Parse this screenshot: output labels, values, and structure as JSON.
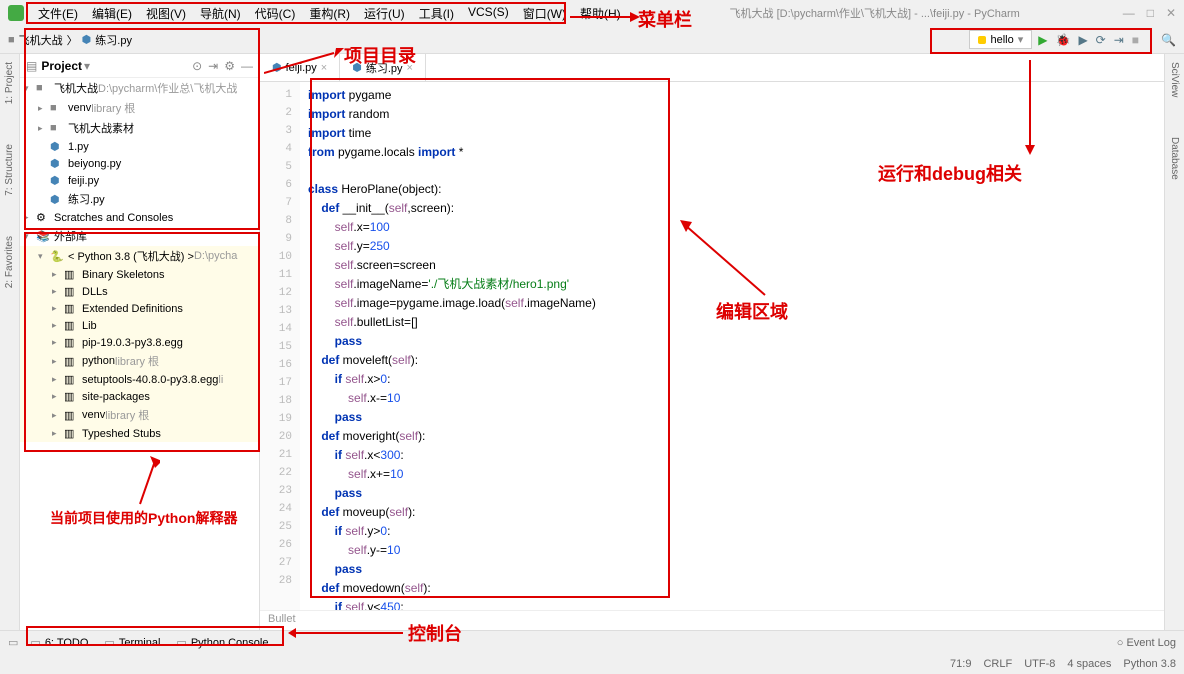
{
  "window": {
    "title": "飞机大战 [D:\\pycharm\\作业\\飞机大战] - ...\\feiji.py - PyCharm"
  },
  "menu": [
    "文件(E)",
    "编辑(E)",
    "视图(V)",
    "导航(N)",
    "代码(C)",
    "重构(R)",
    "运行(U)",
    "工具(I)",
    "VCS(S)",
    "窗口(W)",
    "帮助(H)"
  ],
  "breadcrumb": [
    "飞机大战",
    "练习.py"
  ],
  "run_config": "hello",
  "tabs": [
    "feiji.py",
    "练习.py"
  ],
  "project": {
    "label": "Project",
    "root": {
      "name": "飞机大战",
      "path": "D:\\pycharm\\作业总\\飞机大战"
    },
    "venv": {
      "name": "venv",
      "suffix": "library 根"
    },
    "material": "飞机大战素材",
    "files": [
      "1.py",
      "beiyong.py",
      "feiji.py",
      "练习.py"
    ],
    "scratches": "Scratches and Consoles",
    "external": "外部库",
    "python": {
      "name": "< Python 3.8 (飞机大战) >",
      "path": "D:\\pycha"
    },
    "libs": [
      {
        "name": "Binary Skeletons",
        "suffix": ""
      },
      {
        "name": "DLLs",
        "suffix": ""
      },
      {
        "name": "Extended Definitions",
        "suffix": ""
      },
      {
        "name": "Lib",
        "suffix": ""
      },
      {
        "name": "pip-19.0.3-py3.8.egg",
        "suffix": ""
      },
      {
        "name": "python",
        "suffix": "library 根"
      },
      {
        "name": "setuptools-40.8.0-py3.8.egg",
        "suffix": "li"
      },
      {
        "name": "site-packages",
        "suffix": ""
      },
      {
        "name": "venv",
        "suffix": "library 根"
      },
      {
        "name": "Typeshed Stubs",
        "suffix": ""
      }
    ]
  },
  "code_lines": [
    [
      {
        "t": "import",
        "c": "kw"
      },
      {
        "t": " pygame",
        "c": "ident"
      }
    ],
    [
      {
        "t": "import",
        "c": "kw"
      },
      {
        "t": " random",
        "c": "ident"
      }
    ],
    [
      {
        "t": "import",
        "c": "kw"
      },
      {
        "t": " time",
        "c": "ident"
      }
    ],
    [
      {
        "t": "from",
        "c": "kw"
      },
      {
        "t": " pygame.locals ",
        "c": "ident"
      },
      {
        "t": "import",
        "c": "kw"
      },
      {
        "t": " *",
        "c": "ident"
      }
    ],
    [],
    [
      {
        "t": "class",
        "c": "kw"
      },
      {
        "t": " HeroPlane(",
        "c": "decl"
      },
      {
        "t": "object",
        "c": "builtin"
      },
      {
        "t": "):",
        "c": "decl"
      }
    ],
    [
      {
        "t": "    ",
        "c": ""
      },
      {
        "t": "def",
        "c": "kw"
      },
      {
        "t": " __init__(",
        "c": "decl"
      },
      {
        "t": "self",
        "c": "self"
      },
      {
        "t": ",screen):",
        "c": "decl"
      }
    ],
    [
      {
        "t": "        ",
        "c": ""
      },
      {
        "t": "self",
        "c": "self"
      },
      {
        "t": ".x=",
        "c": "ident"
      },
      {
        "t": "100",
        "c": "num"
      }
    ],
    [
      {
        "t": "        ",
        "c": ""
      },
      {
        "t": "self",
        "c": "self"
      },
      {
        "t": ".y=",
        "c": "ident"
      },
      {
        "t": "250",
        "c": "num"
      }
    ],
    [
      {
        "t": "        ",
        "c": ""
      },
      {
        "t": "self",
        "c": "self"
      },
      {
        "t": ".screen=screen",
        "c": "ident"
      }
    ],
    [
      {
        "t": "        ",
        "c": ""
      },
      {
        "t": "self",
        "c": "self"
      },
      {
        "t": ".imageName=",
        "c": "ident"
      },
      {
        "t": "'./飞机大战素材/hero1.png'",
        "c": "str"
      }
    ],
    [
      {
        "t": "        ",
        "c": ""
      },
      {
        "t": "self",
        "c": "self"
      },
      {
        "t": ".image=pygame.image.load(",
        "c": "ident"
      },
      {
        "t": "self",
        "c": "self"
      },
      {
        "t": ".imageName)",
        "c": "ident"
      }
    ],
    [
      {
        "t": "        ",
        "c": ""
      },
      {
        "t": "self",
        "c": "self"
      },
      {
        "t": ".bulletList=[]",
        "c": "ident"
      }
    ],
    [
      {
        "t": "        ",
        "c": ""
      },
      {
        "t": "pass",
        "c": "kw"
      }
    ],
    [
      {
        "t": "    ",
        "c": ""
      },
      {
        "t": "def",
        "c": "kw"
      },
      {
        "t": " moveleft(",
        "c": "decl"
      },
      {
        "t": "self",
        "c": "self"
      },
      {
        "t": "):",
        "c": "decl"
      }
    ],
    [
      {
        "t": "        ",
        "c": ""
      },
      {
        "t": "if",
        "c": "kw"
      },
      {
        "t": " ",
        "c": ""
      },
      {
        "t": "self",
        "c": "self"
      },
      {
        "t": ".x>",
        "c": "ident"
      },
      {
        "t": "0",
        "c": "num"
      },
      {
        "t": ":",
        "c": "ident"
      }
    ],
    [
      {
        "t": "            ",
        "c": ""
      },
      {
        "t": "self",
        "c": "self"
      },
      {
        "t": ".x-=",
        "c": "ident"
      },
      {
        "t": "10",
        "c": "num"
      }
    ],
    [
      {
        "t": "        ",
        "c": ""
      },
      {
        "t": "pass",
        "c": "kw"
      }
    ],
    [
      {
        "t": "    ",
        "c": ""
      },
      {
        "t": "def",
        "c": "kw"
      },
      {
        "t": " moveright(",
        "c": "decl"
      },
      {
        "t": "self",
        "c": "self"
      },
      {
        "t": "):",
        "c": "decl"
      }
    ],
    [
      {
        "t": "        ",
        "c": ""
      },
      {
        "t": "if",
        "c": "kw"
      },
      {
        "t": " ",
        "c": ""
      },
      {
        "t": "self",
        "c": "self"
      },
      {
        "t": ".x<",
        "c": "ident"
      },
      {
        "t": "300",
        "c": "num"
      },
      {
        "t": ":",
        "c": "ident"
      }
    ],
    [
      {
        "t": "            ",
        "c": ""
      },
      {
        "t": "self",
        "c": "self"
      },
      {
        "t": ".x+=",
        "c": "ident"
      },
      {
        "t": "10",
        "c": "num"
      }
    ],
    [
      {
        "t": "        ",
        "c": ""
      },
      {
        "t": "pass",
        "c": "kw"
      }
    ],
    [
      {
        "t": "    ",
        "c": ""
      },
      {
        "t": "def",
        "c": "kw"
      },
      {
        "t": " moveup(",
        "c": "decl"
      },
      {
        "t": "self",
        "c": "self"
      },
      {
        "t": "):",
        "c": "decl"
      }
    ],
    [
      {
        "t": "        ",
        "c": ""
      },
      {
        "t": "if",
        "c": "kw"
      },
      {
        "t": " ",
        "c": ""
      },
      {
        "t": "self",
        "c": "self"
      },
      {
        "t": ".y>",
        "c": "ident"
      },
      {
        "t": "0",
        "c": "num"
      },
      {
        "t": ":",
        "c": "ident"
      }
    ],
    [
      {
        "t": "            ",
        "c": ""
      },
      {
        "t": "self",
        "c": "self"
      },
      {
        "t": ".y-=",
        "c": "ident"
      },
      {
        "t": "10",
        "c": "num"
      }
    ],
    [
      {
        "t": "        ",
        "c": ""
      },
      {
        "t": "pass",
        "c": "kw"
      }
    ],
    [
      {
        "t": "    ",
        "c": ""
      },
      {
        "t": "def",
        "c": "kw"
      },
      {
        "t": " movedown(",
        "c": "decl"
      },
      {
        "t": "self",
        "c": "self"
      },
      {
        "t": "):",
        "c": "decl"
      }
    ],
    [
      {
        "t": "        ",
        "c": ""
      },
      {
        "t": "if",
        "c": "kw"
      },
      {
        "t": " ",
        "c": ""
      },
      {
        "t": "self",
        "c": "self"
      },
      {
        "t": ".y<",
        "c": "ident"
      },
      {
        "t": "450",
        "c": "num"
      },
      {
        "t": ":",
        "c": "ident"
      }
    ]
  ],
  "crumb": "Bullet",
  "bottom_tools": [
    "6: TODO",
    "Terminal",
    "Python Console"
  ],
  "event_log": "Event Log",
  "status": {
    "pos": "71:9",
    "eol": "CRLF",
    "encoding": "UTF-8",
    "indent": "4 spaces",
    "python": "Python 3.8"
  },
  "annotations": {
    "menu": "菜单栏",
    "project_dir": "项目目录",
    "run_debug": "运行和debug相关",
    "edit_area": "编辑区域",
    "interpreter": "当前项目使用的Python解释器",
    "console": "控制台"
  },
  "left_tabs": [
    "1: Project",
    "7: Structure",
    "2: Favorites"
  ],
  "right_tabs": [
    "SciView",
    "Database"
  ]
}
